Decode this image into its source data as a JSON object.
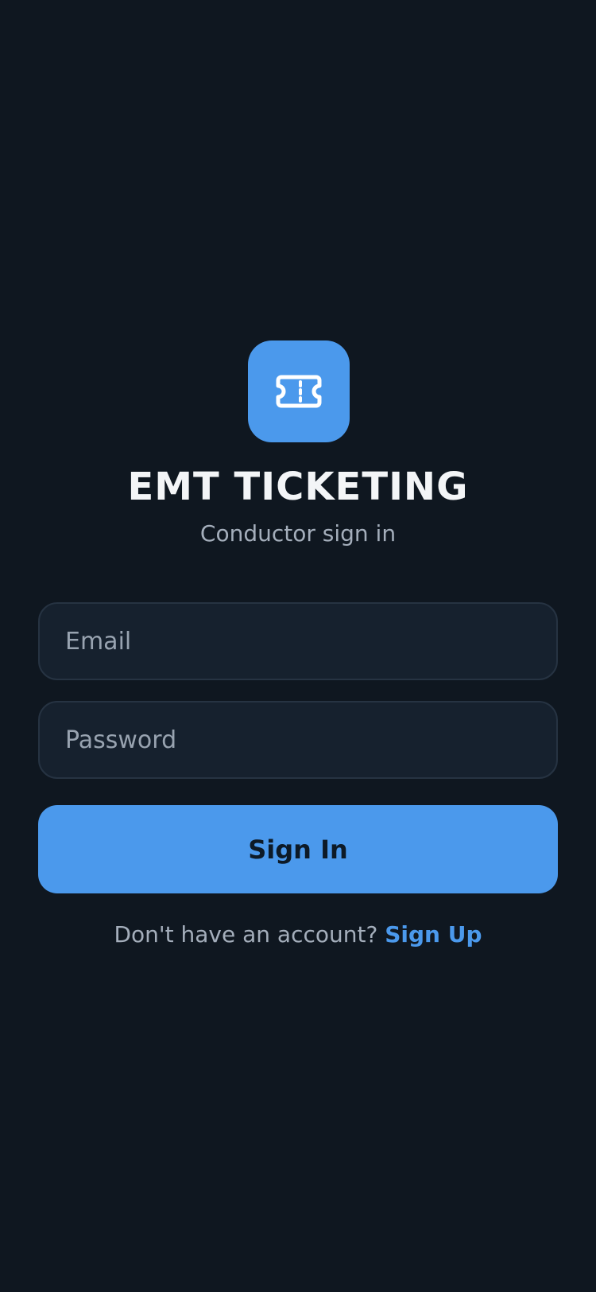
{
  "app": {
    "icon": "ticket-icon",
    "title": "EMT TICKETING",
    "subtitle": "Conductor sign in"
  },
  "form": {
    "email_placeholder": "Email",
    "email_value": "",
    "password_placeholder": "Password",
    "password_value": "",
    "submit_label": "Sign In"
  },
  "footer": {
    "prompt": "Don't have an account? ",
    "link_label": "Sign Up"
  },
  "colors": {
    "background": "#0f1720",
    "accent": "#4b99ec",
    "field_background": "#16212e",
    "field_border": "#263342",
    "title": "#f3f5f7",
    "muted_text": "#a4aebb"
  }
}
